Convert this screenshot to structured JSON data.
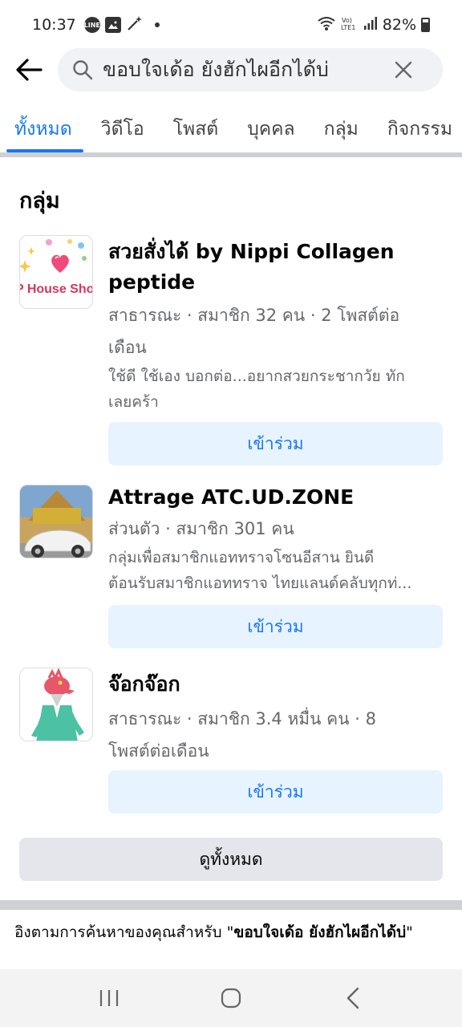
{
  "status": {
    "time": "10:37",
    "battery": "82%",
    "left_icons": [
      "line-icon",
      "gallery-icon",
      "magic-wand-icon"
    ],
    "right_icons": [
      "wifi-icon",
      "volte-icon",
      "signal-icon",
      "battery-icon"
    ]
  },
  "search": {
    "query": "ขอบใจเด้อ ยังฮักไผอีกได้บ่"
  },
  "tabs": [
    {
      "label": "ทั้งหมด",
      "active": true
    },
    {
      "label": "วิดีโอ"
    },
    {
      "label": "โพสต์"
    },
    {
      "label": "บุคคล"
    },
    {
      "label": "กลุ่ม"
    },
    {
      "label": "กิจกรรม"
    }
  ],
  "groups_section": {
    "title": "กลุ่ม",
    "items": [
      {
        "name_line1": "สวยสั่งได้ by Nippi Collagen",
        "name_line2": "peptide",
        "meta_line1": "สาธารณะ · สมาชิก 32 คน · 2 โพสต์ต่อ",
        "meta_line2": "เดือน",
        "desc_line1": "ใช้ดี ใช้เอง บอกต่อ...อยากสวยกระชากวัย ทัก",
        "desc_line2": "เลยคร้า",
        "thumb_text": "P House Shop",
        "join_label": "เข้าร่วม"
      },
      {
        "name_line1": "Attrage ATC.UD.ZONE",
        "meta_line1": "ส่วนตัว · สมาชิก 301 คน",
        "desc_line1": "กลุ่มเพื่อสมาชิกแอททราจโซนอีสาน  ยินดี",
        "desc_line2": "ต้อนรับสมาชิกแอททราจ ไทยแลนด์คลับทุกท่...",
        "join_label": "เข้าร่วม"
      },
      {
        "name_line1": "จ๊อกจ๊อก",
        "meta_line1": "สาธารณะ · สมาชิก 3.4 หมื่น คน · 8",
        "meta_line2": "โพสต์ต่อเดือน",
        "join_label": "เข้าร่วม"
      }
    ],
    "see_all_label": "ดูทั้งหมด"
  },
  "based_on": {
    "prefix": "อิงตามการค้นหาของคุณสำหรับ \"",
    "query_bold": "ขอบใจเด้อ ยังฮักไผอีกได้บ่",
    "suffix": "\""
  },
  "colors": {
    "accent": "#1877f2",
    "join_bg": "#e7f3ff",
    "secondary_text": "#65676b"
  }
}
